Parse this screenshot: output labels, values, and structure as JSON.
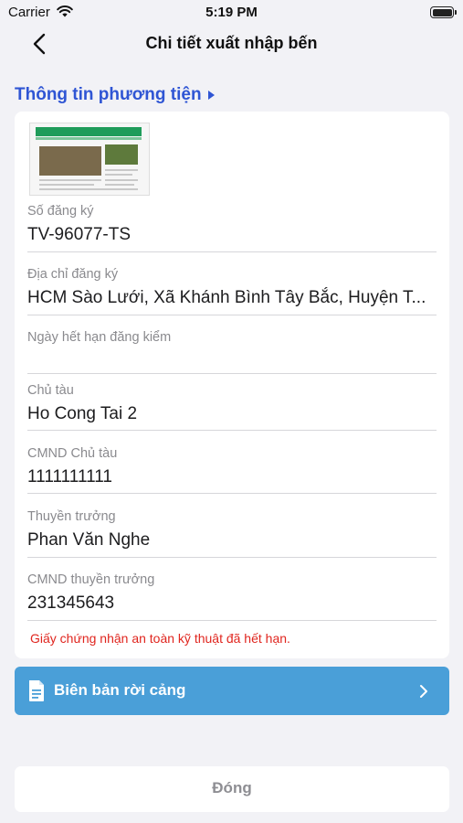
{
  "status_bar": {
    "carrier": "Carrier",
    "time": "5:19 PM"
  },
  "nav": {
    "title": "Chi tiết xuất nhập bến",
    "back_icon": "chevron-left-icon"
  },
  "section": {
    "title": "Thông tin phương tiện"
  },
  "fields": {
    "reg_number": {
      "label": "Số đăng ký",
      "value": "TV-96077-TS"
    },
    "reg_address": {
      "label": "Địa chỉ đăng ký",
      "value": "HCM Sào Lưới, Xã Khánh Bình Tây Bắc, Huyện T..."
    },
    "inspection_expiry": {
      "label": "Ngày hết hạn đăng kiểm",
      "value": ""
    },
    "owner": {
      "label": "Chủ tàu",
      "value": "Ho Cong Tai 2"
    },
    "owner_id": {
      "label": "CMND Chủ tàu",
      "value": "1111111111"
    },
    "captain": {
      "label": "Thuyền trưởng",
      "value": "Phan Văn Nghe"
    },
    "captain_id": {
      "label": "CMND thuyền trưởng",
      "value": "231345643"
    }
  },
  "warning": "Giấy chứng nhận an toàn kỹ thuật đã hết hạn.",
  "report_button": {
    "label": "Biên bản rời cảng",
    "icon": "document-icon"
  },
  "close_button": {
    "label": "Đóng"
  },
  "colors": {
    "accent": "#2f55d4",
    "button": "#4a9fd8",
    "warning": "#e0251e"
  }
}
